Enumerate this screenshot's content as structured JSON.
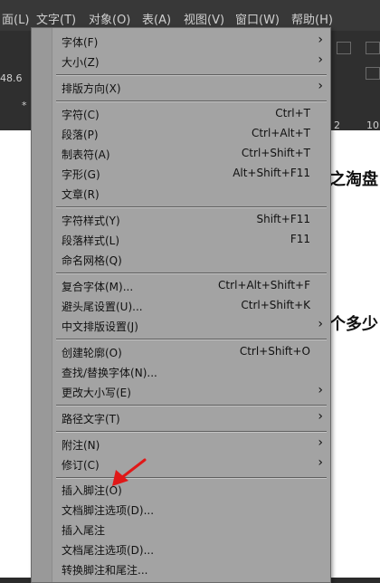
{
  "menubar": {
    "items": [
      "面(L)",
      "文字(T)",
      "对象(O)",
      "表(A)",
      "视图(V)",
      "窗口(W)",
      "帮助(H)"
    ]
  },
  "toolbar": {
    "size_value": "48.6",
    "left_marker": "*",
    "right_numbers": [
      "2",
      "10"
    ]
  },
  "document": {
    "line1": "之淘盘",
    "line2": "个多少"
  },
  "menu": {
    "items": [
      {
        "label": "字体(F)",
        "shortcut": "",
        "submenu": true
      },
      {
        "label": "大小(Z)",
        "shortcut": "",
        "submenu": true
      },
      {
        "label": "排版方向(X)",
        "shortcut": "",
        "submenu": true
      },
      {
        "label": "字符(C)",
        "shortcut": "Ctrl+T",
        "submenu": false
      },
      {
        "label": "段落(P)",
        "shortcut": "Ctrl+Alt+T",
        "submenu": false
      },
      {
        "label": "制表符(A)",
        "shortcut": "Ctrl+Shift+T",
        "submenu": false
      },
      {
        "label": "字形(G)",
        "shortcut": "Alt+Shift+F11",
        "submenu": false
      },
      {
        "label": "文章(R)",
        "shortcut": "",
        "submenu": false
      },
      {
        "label": "字符样式(Y)",
        "shortcut": "Shift+F11",
        "submenu": false
      },
      {
        "label": "段落样式(L)",
        "shortcut": "F11",
        "submenu": false
      },
      {
        "label": "命名网格(Q)",
        "shortcut": "",
        "submenu": false
      },
      {
        "label": "复合字体(M)...",
        "shortcut": "Ctrl+Alt+Shift+F",
        "submenu": false
      },
      {
        "label": "避头尾设置(U)...",
        "shortcut": "Ctrl+Shift+K",
        "submenu": false
      },
      {
        "label": "中文排版设置(J)",
        "shortcut": "",
        "submenu": true
      },
      {
        "label": "创建轮廓(O)",
        "shortcut": "Ctrl+Shift+O",
        "submenu": false
      },
      {
        "label": "查找/替换字体(N)...",
        "shortcut": "",
        "submenu": false
      },
      {
        "label": "更改大小写(E)",
        "shortcut": "",
        "submenu": true
      },
      {
        "label": "路径文字(T)",
        "shortcut": "",
        "submenu": true
      },
      {
        "label": "附注(N)",
        "shortcut": "",
        "submenu": true
      },
      {
        "label": "修订(C)",
        "shortcut": "",
        "submenu": true
      },
      {
        "label": "插入脚注(O)",
        "shortcut": "",
        "submenu": false
      },
      {
        "label": "文档脚注选项(D)...",
        "shortcut": "",
        "submenu": false
      },
      {
        "label": "插入尾注",
        "shortcut": "",
        "submenu": false
      },
      {
        "label": "文档尾注选项(D)...",
        "shortcut": "",
        "submenu": false
      },
      {
        "label": "转换脚注和尾注...",
        "shortcut": "",
        "submenu": false
      }
    ],
    "submenu_arrow": "›"
  },
  "colors": {
    "menu_bg": "#a3a3a3",
    "annotation_arrow": "#e01818"
  }
}
